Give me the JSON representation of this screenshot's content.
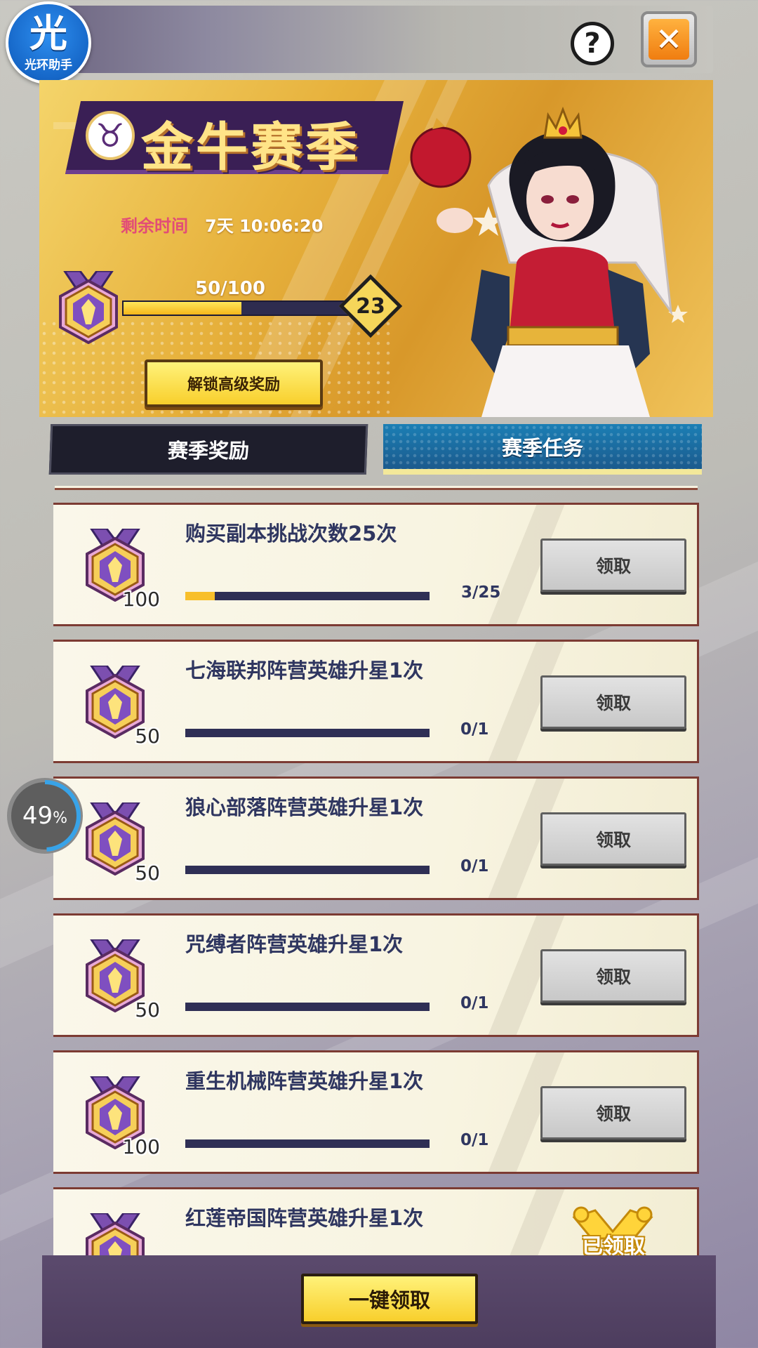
{
  "app_badge": {
    "glyph": "光",
    "name": "光环助手"
  },
  "header": {
    "help_glyph": "?",
    "close_glyph": "✕"
  },
  "banner": {
    "taurus_glyph": "♉",
    "title": "金牛赛季",
    "time_label": "剩余时间",
    "time_value": "7天 10:06:20",
    "xp_text": "50/100",
    "xp_progress": 0.5,
    "level": "23",
    "unlock_button": "解锁高级奖励"
  },
  "tabs": [
    {
      "label": "赛季奖励",
      "active": false
    },
    {
      "label": "赛季任务",
      "active": true
    }
  ],
  "tasks": [
    {
      "title": "购买副本挑战次数25次",
      "points": "100",
      "progress_text": "3/25",
      "progress": 0.12,
      "button": "领取",
      "claimed": false
    },
    {
      "title": "七海联邦阵营英雄升星1次",
      "points": "50",
      "progress_text": "0/1",
      "progress": 0,
      "button": "领取",
      "claimed": false
    },
    {
      "title": "狼心部落阵营英雄升星1次",
      "points": "50",
      "progress_text": "0/1",
      "progress": 0,
      "button": "领取",
      "claimed": false
    },
    {
      "title": "咒缚者阵营英雄升星1次",
      "points": "50",
      "progress_text": "0/1",
      "progress": 0,
      "button": "领取",
      "claimed": false
    },
    {
      "title": "重生机械阵营英雄升星1次",
      "points": "100",
      "progress_text": "0/1",
      "progress": 0,
      "button": "领取",
      "claimed": false
    },
    {
      "title": "红莲帝国阵营英雄升星1次",
      "points": "",
      "progress_text": "",
      "progress": 0,
      "button": "已领取",
      "claimed": true
    }
  ],
  "side_widget": {
    "value": "49",
    "unit": "%"
  },
  "footer": {
    "claim_all": "一键领取"
  },
  "colors": {
    "accent_gold": "#f8cf2c",
    "tab_active": "#1b7fb5",
    "tab_inactive": "#1e1e2c",
    "task_title": "#2f3660",
    "card_border": "#7c3b33"
  }
}
